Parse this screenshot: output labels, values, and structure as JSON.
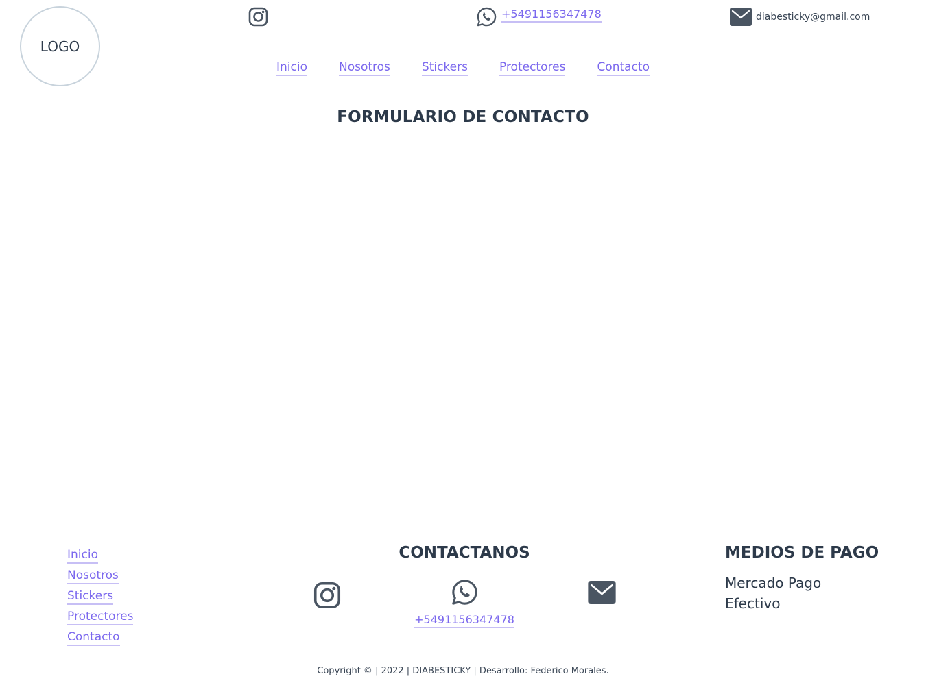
{
  "header": {
    "logo_text": "LOGO",
    "phone": "+5491156347478",
    "email": "diabesticky@gmail.com",
    "icons": [
      "instagram-icon",
      "whatsapp-icon",
      "mail-icon"
    ]
  },
  "nav": {
    "items": [
      {
        "label": "Inicio"
      },
      {
        "label": "Nosotros"
      },
      {
        "label": "Stickers"
      },
      {
        "label": "Protectores"
      },
      {
        "label": "Contacto"
      }
    ]
  },
  "main": {
    "title": "FORMULARIO DE CONTACTO"
  },
  "footer": {
    "nav_items": [
      {
        "label": "Inicio"
      },
      {
        "label": "Nosotros"
      },
      {
        "label": "Stickers"
      },
      {
        "label": "Protectores"
      },
      {
        "label": "Contacto"
      }
    ],
    "contact_title": "CONTACTANOS",
    "phone": "+5491156347478",
    "payment_title": "MEDIOS DE PAGO",
    "payment_methods": [
      "Mercado Pago",
      "Efectivo"
    ],
    "copyright": "Copyright © | 2022 | DIABESTICKY | Desarrollo: Federico Morales."
  },
  "colors": {
    "link": "#7b68ee",
    "link_underline": "#c7bff5",
    "text": "#2d3a4a",
    "icon": "#4a5562",
    "logo_border": "#c8d3dc"
  }
}
